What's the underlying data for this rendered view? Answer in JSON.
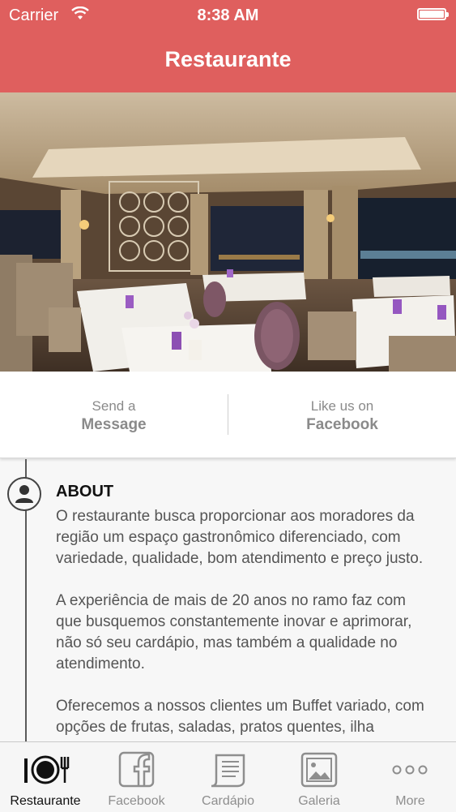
{
  "status_bar": {
    "carrier": "Carrier",
    "time": "8:38 AM",
    "battery_level": 1.0
  },
  "nav": {
    "title": "Restaurante"
  },
  "hero": {
    "subject": "restaurant dining room"
  },
  "actions": [
    {
      "line1": "Send a",
      "line2": "Message"
    },
    {
      "line1": "Like us on",
      "line2": "Facebook"
    }
  ],
  "about": {
    "title": "ABOUT",
    "paragraphs": [
      "O restaurante busca proporcionar aos moradores da região um espaço gastronômico diferenciado, com variedade, qualidade, bom atendimento e preço justo.",
      "A experiência de mais de 20 anos no ramo faz com que busquemos constantemente inovar e aprimorar, não só seu cardápio, mas também a qualidade no atendimento.",
      "Oferecemos a nossos clientes um Buffet variado, com opções de frutas, saladas, pratos quentes, ilha"
    ]
  },
  "tabs": [
    {
      "label": "Restaurante",
      "icon": "plate-cutlery-icon",
      "active": true
    },
    {
      "label": "Facebook",
      "icon": "facebook-icon",
      "active": false
    },
    {
      "label": "Cardápio",
      "icon": "menu-scroll-icon",
      "active": false
    },
    {
      "label": "Galeria",
      "icon": "gallery-icon",
      "active": false
    },
    {
      "label": "More",
      "icon": "more-dots-icon",
      "active": false
    }
  ],
  "colors": {
    "brand": "#df5f5e",
    "tab_active": "#111111",
    "tab_inactive": "#8e8e8e"
  }
}
